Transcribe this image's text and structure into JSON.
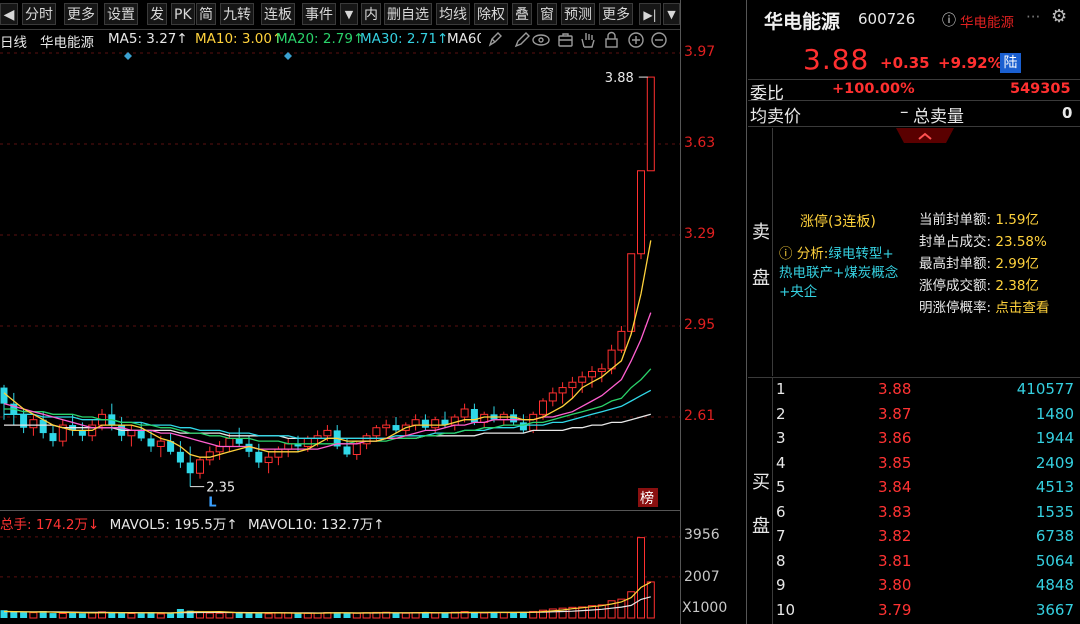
{
  "toolbar": {
    "items": [
      "◀",
      "分时",
      "更多",
      "设置",
      "发",
      "PK",
      "简",
      "九转",
      "连板",
      "事件",
      "▼",
      "内",
      "删自选",
      "均线",
      "除权",
      "叠",
      "窗",
      "预测",
      "更多",
      "▶|",
      "▼"
    ]
  },
  "chart_info": {
    "period": "日线",
    "name": "华电能源",
    "ma5": "MA5: 3.27↑",
    "ma10": "MA10: 3.00↑",
    "ma20": "MA20: 2.79↑",
    "ma30": "MA30: 2.71↑",
    "ma60": "MA60"
  },
  "price_axis": [
    "3.97",
    "3.63",
    "3.29",
    "2.95",
    "2.61"
  ],
  "chart_data": {
    "type": "candlestick",
    "ylim": [
      2.3,
      3.97
    ],
    "high_label": "3.88",
    "low_label": "2.35",
    "low_marker": "L",
    "rank_badge": "榜",
    "candles": [
      [
        2.72,
        2.73,
        2.6,
        2.66
      ],
      [
        2.66,
        2.7,
        2.58,
        2.62
      ],
      [
        2.62,
        2.64,
        2.55,
        2.57
      ],
      [
        2.57,
        2.62,
        2.54,
        2.6
      ],
      [
        2.6,
        2.63,
        2.53,
        2.55
      ],
      [
        2.55,
        2.58,
        2.5,
        2.52
      ],
      [
        2.52,
        2.6,
        2.5,
        2.58
      ],
      [
        2.58,
        2.62,
        2.54,
        2.56
      ],
      [
        2.56,
        2.59,
        2.52,
        2.54
      ],
      [
        2.54,
        2.6,
        2.52,
        2.58
      ],
      [
        2.58,
        2.64,
        2.56,
        2.62
      ],
      [
        2.62,
        2.66,
        2.56,
        2.58
      ],
      [
        2.58,
        2.61,
        2.52,
        2.54
      ],
      [
        2.54,
        2.58,
        2.5,
        2.56
      ],
      [
        2.56,
        2.59,
        2.52,
        2.53
      ],
      [
        2.53,
        2.56,
        2.48,
        2.5
      ],
      [
        2.5,
        2.54,
        2.46,
        2.52
      ],
      [
        2.52,
        2.55,
        2.47,
        2.48
      ],
      [
        2.48,
        2.52,
        2.42,
        2.44
      ],
      [
        2.44,
        2.5,
        2.35,
        2.4
      ],
      [
        2.4,
        2.46,
        2.38,
        2.45
      ],
      [
        2.45,
        2.5,
        2.43,
        2.48
      ],
      [
        2.48,
        2.52,
        2.45,
        2.5
      ],
      [
        2.5,
        2.55,
        2.48,
        2.53
      ],
      [
        2.53,
        2.57,
        2.5,
        2.51
      ],
      [
        2.51,
        2.54,
        2.46,
        2.48
      ],
      [
        2.48,
        2.51,
        2.42,
        2.44
      ],
      [
        2.44,
        2.48,
        2.4,
        2.46
      ],
      [
        2.46,
        2.5,
        2.43,
        2.49
      ],
      [
        2.49,
        2.53,
        2.46,
        2.51
      ],
      [
        2.51,
        2.54,
        2.48,
        2.5
      ],
      [
        2.5,
        2.54,
        2.48,
        2.53
      ],
      [
        2.53,
        2.56,
        2.5,
        2.54
      ],
      [
        2.54,
        2.58,
        2.52,
        2.56
      ],
      [
        2.56,
        2.58,
        2.49,
        2.5
      ],
      [
        2.5,
        2.53,
        2.46,
        2.47
      ],
      [
        2.47,
        2.52,
        2.45,
        2.51
      ],
      [
        2.51,
        2.55,
        2.49,
        2.54
      ],
      [
        2.54,
        2.58,
        2.52,
        2.57
      ],
      [
        2.57,
        2.6,
        2.54,
        2.58
      ],
      [
        2.58,
        2.61,
        2.55,
        2.56
      ],
      [
        2.56,
        2.59,
        2.54,
        2.58
      ],
      [
        2.58,
        2.62,
        2.56,
        2.6
      ],
      [
        2.6,
        2.62,
        2.56,
        2.57
      ],
      [
        2.57,
        2.61,
        2.55,
        2.6
      ],
      [
        2.6,
        2.63,
        2.57,
        2.58
      ],
      [
        2.58,
        2.62,
        2.56,
        2.61
      ],
      [
        2.61,
        2.66,
        2.59,
        2.64
      ],
      [
        2.64,
        2.66,
        2.58,
        2.59
      ],
      [
        2.59,
        2.63,
        2.57,
        2.62
      ],
      [
        2.62,
        2.65,
        2.59,
        2.6
      ],
      [
        2.6,
        2.63,
        2.58,
        2.62
      ],
      [
        2.62,
        2.64,
        2.58,
        2.59
      ],
      [
        2.59,
        2.62,
        2.55,
        2.56
      ],
      [
        2.56,
        2.63,
        2.55,
        2.62
      ],
      [
        2.62,
        2.68,
        2.6,
        2.67
      ],
      [
        2.67,
        2.72,
        2.65,
        2.7
      ],
      [
        2.7,
        2.74,
        2.66,
        2.72
      ],
      [
        2.72,
        2.76,
        2.68,
        2.74
      ],
      [
        2.74,
        2.78,
        2.7,
        2.76
      ],
      [
        2.76,
        2.8,
        2.72,
        2.78
      ],
      [
        2.78,
        2.81,
        2.74,
        2.79
      ],
      [
        2.79,
        2.88,
        2.77,
        2.86
      ],
      [
        2.86,
        2.95,
        2.85,
        2.93
      ],
      [
        2.93,
        3.22,
        2.92,
        3.22
      ],
      [
        3.22,
        3.53,
        3.2,
        3.53
      ],
      [
        3.53,
        3.88,
        3.53,
        3.88
      ]
    ],
    "ma5": [
      2.7,
      2.67,
      2.64,
      2.62,
      2.6,
      2.58,
      2.57,
      2.56,
      2.56,
      2.56,
      2.58,
      2.58,
      2.58,
      2.58,
      2.57,
      2.55,
      2.53,
      2.52,
      2.5,
      2.47,
      2.46,
      2.46,
      2.47,
      2.48,
      2.49,
      2.5,
      2.49,
      2.48,
      2.48,
      2.48,
      2.48,
      2.49,
      2.51,
      2.53,
      2.53,
      2.52,
      2.52,
      2.52,
      2.52,
      2.53,
      2.55,
      2.57,
      2.58,
      2.58,
      2.58,
      2.58,
      2.59,
      2.6,
      2.6,
      2.61,
      2.61,
      2.61,
      2.61,
      2.6,
      2.6,
      2.61,
      2.63,
      2.65,
      2.68,
      2.72,
      2.74,
      2.76,
      2.79,
      2.82,
      2.92,
      3.07,
      3.27
    ],
    "ma10": [
      2.66,
      2.65,
      2.64,
      2.63,
      2.62,
      2.61,
      2.6,
      2.59,
      2.58,
      2.57,
      2.57,
      2.57,
      2.57,
      2.56,
      2.56,
      2.56,
      2.55,
      2.55,
      2.54,
      2.53,
      2.52,
      2.51,
      2.5,
      2.5,
      2.5,
      2.5,
      2.49,
      2.49,
      2.49,
      2.49,
      2.49,
      2.49,
      2.49,
      2.5,
      2.51,
      2.51,
      2.51,
      2.52,
      2.52,
      2.53,
      2.53,
      2.54,
      2.55,
      2.56,
      2.56,
      2.57,
      2.58,
      2.58,
      2.59,
      2.59,
      2.6,
      2.6,
      2.6,
      2.6,
      2.6,
      2.61,
      2.61,
      2.62,
      2.63,
      2.65,
      2.67,
      2.69,
      2.72,
      2.75,
      2.82,
      2.9,
      3.0
    ],
    "ma20": [
      2.64,
      2.64,
      2.63,
      2.63,
      2.63,
      2.62,
      2.62,
      2.62,
      2.61,
      2.61,
      2.6,
      2.6,
      2.59,
      2.59,
      2.58,
      2.58,
      2.57,
      2.57,
      2.56,
      2.55,
      2.55,
      2.54,
      2.54,
      2.53,
      2.53,
      2.53,
      2.52,
      2.52,
      2.52,
      2.51,
      2.51,
      2.51,
      2.51,
      2.51,
      2.51,
      2.51,
      2.52,
      2.52,
      2.52,
      2.52,
      2.53,
      2.53,
      2.53,
      2.54,
      2.54,
      2.55,
      2.55,
      2.56,
      2.56,
      2.57,
      2.57,
      2.58,
      2.58,
      2.58,
      2.59,
      2.59,
      2.6,
      2.61,
      2.62,
      2.63,
      2.64,
      2.65,
      2.67,
      2.68,
      2.72,
      2.75,
      2.79
    ],
    "ma30": [
      2.62,
      2.62,
      2.62,
      2.62,
      2.61,
      2.61,
      2.61,
      2.61,
      2.6,
      2.6,
      2.6,
      2.6,
      2.59,
      2.59,
      2.59,
      2.58,
      2.58,
      2.58,
      2.57,
      2.57,
      2.56,
      2.56,
      2.56,
      2.55,
      2.55,
      2.55,
      2.54,
      2.54,
      2.54,
      2.54,
      2.53,
      2.53,
      2.53,
      2.53,
      2.53,
      2.53,
      2.53,
      2.53,
      2.53,
      2.53,
      2.54,
      2.54,
      2.54,
      2.54,
      2.55,
      2.55,
      2.55,
      2.56,
      2.56,
      2.56,
      2.57,
      2.57,
      2.57,
      2.58,
      2.58,
      2.58,
      2.59,
      2.59,
      2.6,
      2.61,
      2.62,
      2.63,
      2.64,
      2.65,
      2.67,
      2.69,
      2.71
    ],
    "ma60": [
      2.58,
      2.58,
      2.58,
      2.58,
      2.58,
      2.58,
      2.57,
      2.57,
      2.57,
      2.57,
      2.57,
      2.57,
      2.56,
      2.56,
      2.56,
      2.56,
      2.56,
      2.56,
      2.55,
      2.55,
      2.55,
      2.55,
      2.55,
      2.54,
      2.54,
      2.54,
      2.54,
      2.54,
      2.54,
      2.53,
      2.53,
      2.53,
      2.53,
      2.53,
      2.53,
      2.53,
      2.53,
      2.53,
      2.53,
      2.53,
      2.53,
      2.53,
      2.53,
      2.54,
      2.54,
      2.54,
      2.54,
      2.54,
      2.54,
      2.55,
      2.55,
      2.55,
      2.55,
      2.55,
      2.56,
      2.56,
      2.56,
      2.56,
      2.57,
      2.57,
      2.58,
      2.58,
      2.59,
      2.59,
      2.6,
      2.61,
      2.62
    ],
    "volume": [
      95,
      80,
      70,
      65,
      85,
      60,
      55,
      70,
      58,
      62,
      75,
      68,
      60,
      55,
      58,
      72,
      50,
      64,
      110,
      90,
      70,
      60,
      58,
      66,
      62,
      70,
      55,
      52,
      60,
      64,
      58,
      56,
      60,
      66,
      70,
      62,
      58,
      64,
      68,
      70,
      60,
      58,
      66,
      72,
      60,
      64,
      70,
      78,
      66,
      62,
      70,
      68,
      64,
      72,
      80,
      95,
      110,
      120,
      130,
      135,
      150,
      160,
      210,
      230,
      320,
      980,
      440
    ],
    "vol_ma5": [
      80,
      78,
      75,
      72,
      74,
      71,
      67,
      67,
      66,
      62,
      64,
      66,
      65,
      64,
      63,
      65,
      62,
      60,
      70,
      77,
      77,
      77,
      78,
      72,
      64,
      64,
      62,
      62,
      62,
      61,
      60,
      58,
      58,
      61,
      62,
      62,
      61,
      62,
      64,
      65,
      64,
      63,
      64,
      67,
      65,
      64,
      66,
      70,
      68,
      68,
      69,
      68,
      68,
      69,
      71,
      78,
      86,
      97,
      113,
      124,
      138,
      150,
      171,
      196,
      249,
      373,
      437
    ],
    "vol_ma10": [
      78,
      77,
      76,
      75,
      75,
      74,
      73,
      72,
      70,
      69,
      68,
      67,
      66,
      66,
      65,
      64,
      64,
      63,
      65,
      66,
      67,
      68,
      68,
      67,
      67,
      66,
      65,
      65,
      65,
      64,
      63,
      62,
      61,
      62,
      62,
      62,
      61,
      61,
      61,
      62,
      62,
      62,
      62,
      63,
      63,
      63,
      64,
      66,
      66,
      66,
      67,
      67,
      67,
      68,
      69,
      72,
      75,
      79,
      83,
      90,
      98,
      106,
      119,
      133,
      154,
      227,
      258
    ],
    "volume_axis": [
      "3956",
      "2007"
    ],
    "volume_unit": "X1000"
  },
  "volume_info": {
    "total": "总手: 174.2万↓",
    "mavol5": "MAVOL5: 195.5万↑",
    "mavol10": "MAVOL10: 132.7万↑"
  },
  "quote": {
    "name": "华电能源",
    "code": "600726",
    "tag": "华电能源",
    "price": "3.88",
    "change": "+0.35",
    "pct": "+9.92%",
    "exchange_badge": "陆",
    "weibi_label": "委比",
    "weibi_value": "+100.00%",
    "weibi_count": "549305",
    "avg_sell_label": "均卖价",
    "avg_sell_value": "–",
    "total_sell_label": "总卖量",
    "total_sell_value": "0",
    "sell_side": [
      "卖",
      "盘"
    ],
    "buy_side": [
      "买",
      "盘"
    ]
  },
  "limit_up": {
    "title": "涨停(3连板)",
    "analysis_prefix": "分析:",
    "analysis": [
      "绿电转型+",
      "热电联产+煤炭概念",
      "+央企"
    ],
    "stats": [
      {
        "label": "当前封单额:",
        "value": "1.59亿"
      },
      {
        "label": "封单占成交:",
        "value": "23.58%"
      },
      {
        "label": "最高封单额:",
        "value": "2.99亿"
      },
      {
        "label": "涨停成交额:",
        "value": "2.38亿"
      },
      {
        "label": "明涨停概率:",
        "value": "点击查看"
      }
    ]
  },
  "buy_orders": [
    {
      "level": "1",
      "price": "3.88",
      "volume": "410577"
    },
    {
      "level": "2",
      "price": "3.87",
      "volume": "1480"
    },
    {
      "level": "3",
      "price": "3.86",
      "volume": "1944"
    },
    {
      "level": "4",
      "price": "3.85",
      "volume": "2409"
    },
    {
      "level": "5",
      "price": "3.84",
      "volume": "4513"
    },
    {
      "level": "6",
      "price": "3.83",
      "volume": "1535"
    },
    {
      "level": "7",
      "price": "3.82",
      "volume": "6738"
    },
    {
      "level": "8",
      "price": "3.81",
      "volume": "5064"
    },
    {
      "level": "9",
      "price": "3.80",
      "volume": "4848"
    },
    {
      "level": "10",
      "price": "3.79",
      "volume": "3667"
    }
  ]
}
